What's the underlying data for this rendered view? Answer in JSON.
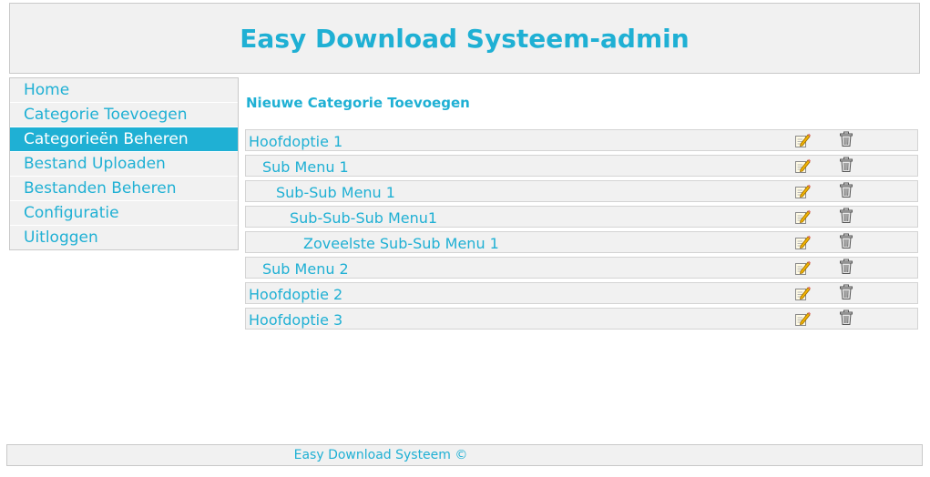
{
  "header": {
    "title": "Easy Download Systeem-admin"
  },
  "sidebar": {
    "items": [
      {
        "label": "Home"
      },
      {
        "label": "Categorie Toevoegen"
      },
      {
        "label": "Categorieën Beheren"
      },
      {
        "label": "Bestand Uploaden"
      },
      {
        "label": "Bestanden Beheren"
      },
      {
        "label": "Configuratie"
      },
      {
        "label": "Uitloggen"
      }
    ],
    "active_index": 2
  },
  "main": {
    "add_link": "Nieuwe Categorie Toevoegen",
    "categories": [
      {
        "label": "Hoofdoptie 1",
        "level": 0
      },
      {
        "label": "Sub Menu 1",
        "level": 1
      },
      {
        "label": "Sub-Sub Menu 1",
        "level": 2
      },
      {
        "label": "Sub-Sub-Sub Menu1",
        "level": 3
      },
      {
        "label": "Zoveelste Sub-Sub Menu 1",
        "level": 4
      },
      {
        "label": "Sub Menu 2",
        "level": 1
      },
      {
        "label": "Hoofdoptie 2",
        "level": 0
      },
      {
        "label": "Hoofdoptie 3",
        "level": 0
      }
    ],
    "row_icons": [
      "edit-icon",
      "trash-icon"
    ]
  },
  "footer": {
    "text": "Easy Download Systeem ©"
  },
  "colors": {
    "accent": "#1fb0d4",
    "panel": "#f1f1f1"
  }
}
